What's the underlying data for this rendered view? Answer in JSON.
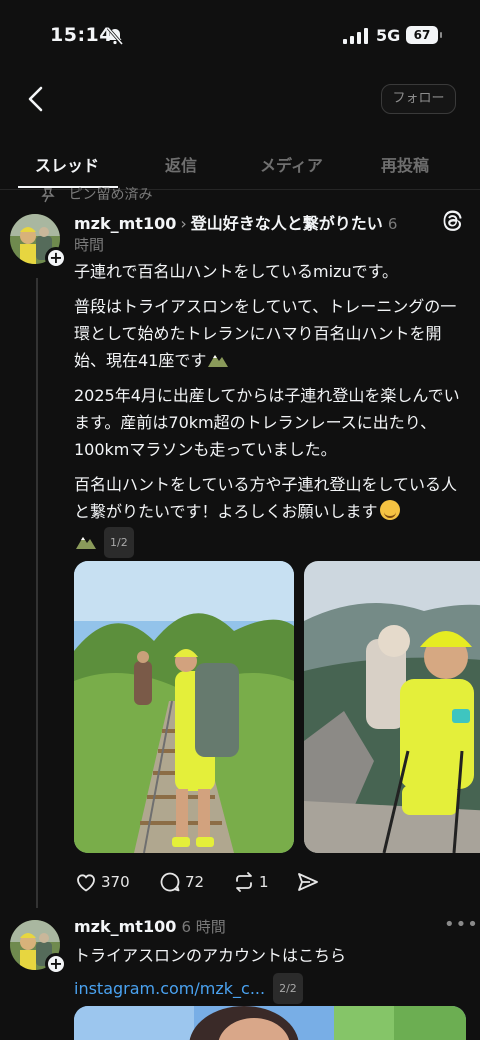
{
  "status_bar": {
    "time": "15:14",
    "network": "5G",
    "battery": "67",
    "icons": [
      "bell-slash-icon",
      "cellular-signal-icon"
    ]
  },
  "header": {
    "follow_label": "フォロー",
    "icons": [
      "back-chevron-icon"
    ]
  },
  "tabs": [
    {
      "label": "スレッド",
      "active": true
    },
    {
      "label": "返信",
      "active": false
    },
    {
      "label": "メディア",
      "active": false
    },
    {
      "label": "再投稿",
      "active": false
    }
  ],
  "pinned_label": "ピン留め済み",
  "post1": {
    "username": "mzk_mt100",
    "topic": "登山好きな人と繋がりたい",
    "time_ago_1": "6",
    "time_ago_2": "時間",
    "paragraphs": [
      "子連れで百名山ハントをしているmizuです。",
      "普段はトライアスロンをしていて、トレーニングの一環として始めたトレランにハマり百名山ハントを開始、現在41座です",
      "2025年4月に出産してからは子連れ登山を楽しんでいます。産前は70km超のトレランレースに出たり、100kmマラソンも走っていました。",
      "百名山ハントをしている方や子連れ登山をしている人と繋がりたいです！よろしくお願いします"
    ],
    "pager": "1/2",
    "likes": "370",
    "replies": "72",
    "reposts": "1"
  },
  "post2": {
    "username": "mzk_mt100",
    "time_ago": "6 時間",
    "text": "トライアスロンのアカウントはこちら",
    "link": "instagram.com/mzk_c...",
    "pager": "2/2"
  },
  "colors": {
    "background": "#101010",
    "text": "#f3f5f7",
    "muted": "#7a7a7a",
    "link": "#4aa2f0",
    "accent_yellow": "#d9e62a"
  }
}
